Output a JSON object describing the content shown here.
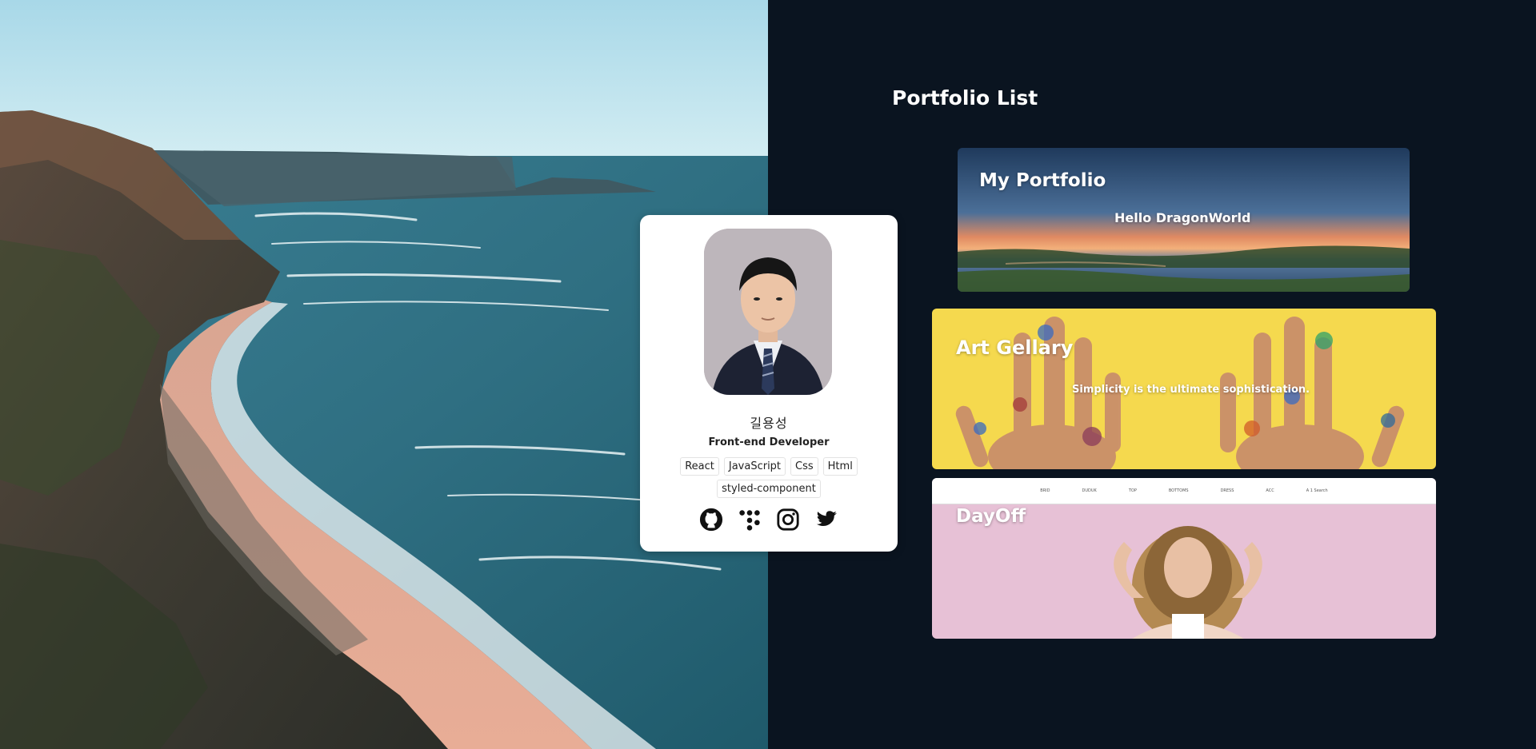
{
  "portfolio_list": {
    "heading": "Portfolio List",
    "items": [
      {
        "title": "My Portfolio",
        "subtitle": "Hello DragonWorld"
      },
      {
        "title": "Art Gellary",
        "subtitle": "Simplicity is the ultimate sophistication."
      },
      {
        "title": "DayOff",
        "nav": [
          "BRID",
          "DUDUK",
          "TOP",
          "BOTTOMS",
          "DRESS",
          "ACC",
          "A 1 Search"
        ]
      }
    ]
  },
  "profile": {
    "name": "길용성",
    "role": "Front-end Developer",
    "skills": [
      "React",
      "JavaScript",
      "Css",
      "Html",
      "styled-component"
    ],
    "socials": [
      {
        "name": "github-icon"
      },
      {
        "name": "tistory-icon"
      },
      {
        "name": "instagram-icon"
      },
      {
        "name": "twitter-icon"
      }
    ]
  },
  "colors": {
    "panel_bg": "#0a1420",
    "card_bg": "#ffffff",
    "art_yellow": "#f5d94e",
    "dayoff_pink": "#e7c1d6"
  }
}
